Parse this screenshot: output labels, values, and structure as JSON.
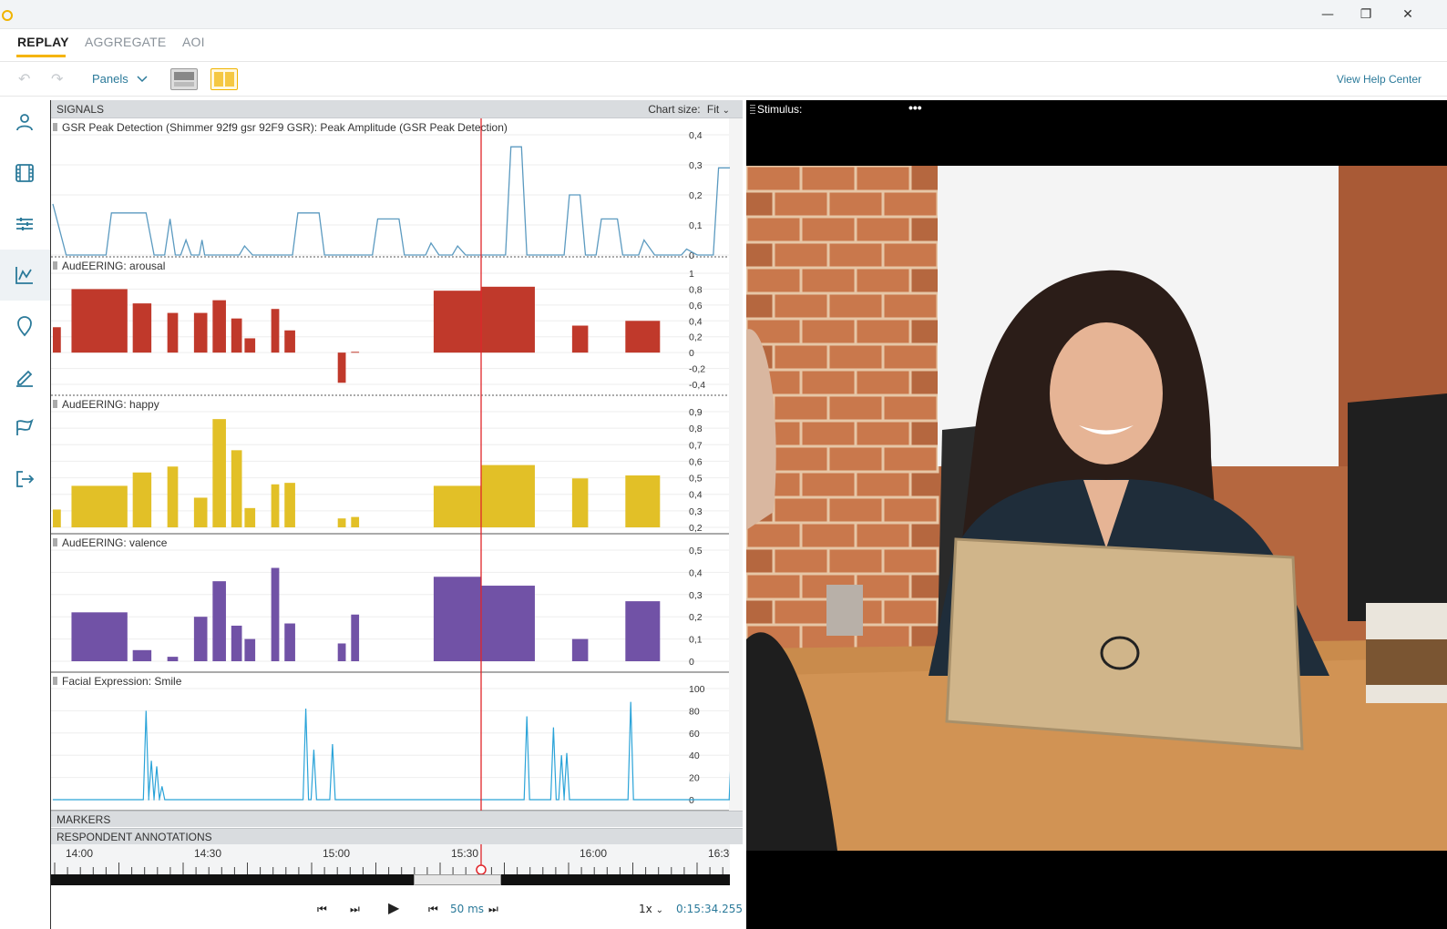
{
  "window": {
    "minimize": "—",
    "restore": "❐",
    "close": "✕"
  },
  "tabs": [
    {
      "label": "REPLAY"
    },
    {
      "label": "AGGREGATE"
    },
    {
      "label": "AOI"
    }
  ],
  "toolbar": {
    "undo": "↶",
    "redo": "↷",
    "panels_label": "Panels",
    "help_label": "View Help Center"
  },
  "sidebar": {
    "items": [
      "respondents-icon",
      "stimuli-icon",
      "settings-sliders-icon",
      "signals-chart-icon",
      "location-pin-icon",
      "annotate-pen-icon",
      "markers-flag-icon",
      "exit-icon"
    ]
  },
  "signals": {
    "header": "SIGNALS",
    "chart_size_label": "Chart size:",
    "chart_size_value": "Fit"
  },
  "chart_data": [
    {
      "type": "line",
      "title": "GSR Peak Detection (Shimmer 92f9 gsr 92F9 GSR): Peak Amplitude (GSR Peak Detection)",
      "y_ticks": [
        "0,4",
        "0,3",
        "0,2",
        "0,1",
        "0"
      ],
      "ylim": [
        0,
        0.4
      ],
      "points": [
        [
          0,
          0.17
        ],
        [
          0.05,
          0
        ],
        [
          0.2,
          0
        ],
        [
          0.22,
          0.14
        ],
        [
          0.35,
          0.14
        ],
        [
          0.38,
          0
        ],
        [
          0.42,
          0
        ],
        [
          0.44,
          0.12
        ],
        [
          0.46,
          0
        ],
        [
          0.48,
          0
        ],
        [
          0.5,
          0.05
        ],
        [
          0.52,
          0
        ],
        [
          0.55,
          0
        ],
        [
          0.56,
          0.05
        ],
        [
          0.57,
          0
        ],
        [
          0.7,
          0
        ],
        [
          0.72,
          0.03
        ],
        [
          0.75,
          0
        ],
        [
          0.9,
          0
        ],
        [
          0.92,
          0.14
        ],
        [
          1.0,
          0.14
        ],
        [
          1.02,
          0
        ],
        [
          1.2,
          0
        ],
        [
          1.22,
          0.12
        ],
        [
          1.3,
          0.12
        ],
        [
          1.32,
          0
        ],
        [
          1.4,
          0
        ],
        [
          1.42,
          0.04
        ],
        [
          1.45,
          0
        ],
        [
          1.5,
          0
        ],
        [
          1.52,
          0.03
        ],
        [
          1.55,
          0
        ],
        [
          1.7,
          0
        ],
        [
          1.72,
          0.36
        ],
        [
          1.76,
          0.36
        ],
        [
          1.78,
          0
        ],
        [
          1.92,
          0
        ],
        [
          1.94,
          0.2
        ],
        [
          1.98,
          0.2
        ],
        [
          2.0,
          0
        ],
        [
          2.04,
          0
        ],
        [
          2.06,
          0.12
        ],
        [
          2.12,
          0.12
        ],
        [
          2.14,
          0
        ],
        [
          2.2,
          0
        ],
        [
          2.22,
          0.05
        ],
        [
          2.26,
          0
        ],
        [
          2.36,
          0
        ],
        [
          2.38,
          0.02
        ],
        [
          2.42,
          0
        ],
        [
          2.48,
          0
        ],
        [
          2.5,
          0.29
        ],
        [
          2.56,
          0.29
        ],
        [
          2.58,
          0
        ],
        [
          2.65,
          0
        ],
        [
          2.66,
          0.16
        ],
        [
          2.72,
          0.16
        ],
        [
          2.74,
          0
        ]
      ]
    },
    {
      "type": "bar",
      "title": "AudEERING: arousal",
      "y_ticks": [
        "1",
        "0,8",
        "0,6",
        "0,4",
        "0,2",
        "0",
        "-0,2",
        "-0,4"
      ],
      "ylim": [
        -0.4,
        1
      ],
      "bars": [
        [
          0,
          0.03,
          0.32
        ],
        [
          0.07,
          0.28,
          0.8
        ],
        [
          0.3,
          0.37,
          0.62
        ],
        [
          0.43,
          0.47,
          0.5
        ],
        [
          0.53,
          0.58,
          0.5
        ],
        [
          0.6,
          0.65,
          0.66
        ],
        [
          0.67,
          0.71,
          0.43
        ],
        [
          0.72,
          0.76,
          0.18
        ],
        [
          0.82,
          0.85,
          0.55
        ],
        [
          0.87,
          0.91,
          0.28
        ],
        [
          1.07,
          1.1,
          -0.38
        ],
        [
          1.12,
          1.15,
          0.01
        ],
        [
          1.43,
          1.61,
          0.78
        ],
        [
          1.61,
          1.81,
          0.83
        ],
        [
          1.95,
          2.01,
          0.34
        ],
        [
          2.15,
          2.28,
          0.4
        ]
      ],
      "color": "#c0392b"
    },
    {
      "type": "bar",
      "title": "AudEERING: happy",
      "y_ticks": [
        "0,9",
        "0,8",
        "0,7",
        "0,6",
        "0,5",
        "0,4",
        "0,3",
        "0,2"
      ],
      "ylim": [
        0.15,
        0.93
      ],
      "bars": [
        [
          0,
          0.03,
          0.27
        ],
        [
          0.07,
          0.28,
          0.43
        ],
        [
          0.3,
          0.37,
          0.52
        ],
        [
          0.43,
          0.47,
          0.56
        ],
        [
          0.53,
          0.58,
          0.35
        ],
        [
          0.6,
          0.65,
          0.88
        ],
        [
          0.67,
          0.71,
          0.67
        ],
        [
          0.72,
          0.76,
          0.28
        ],
        [
          0.82,
          0.85,
          0.44
        ],
        [
          0.87,
          0.91,
          0.45
        ],
        [
          1.07,
          1.1,
          0.21
        ],
        [
          1.12,
          1.15,
          0.22
        ],
        [
          1.43,
          1.61,
          0.43
        ],
        [
          1.61,
          1.81,
          0.57
        ],
        [
          1.95,
          2.01,
          0.48
        ],
        [
          2.15,
          2.28,
          0.5
        ]
      ],
      "color": "#e2c027"
    },
    {
      "type": "bar",
      "title": "AudEERING: valence",
      "y_ticks": [
        "0,5",
        "0,4",
        "0,3",
        "0,2",
        "0,1",
        "0"
      ],
      "ylim": [
        0,
        0.5
      ],
      "bars": [
        [
          0.07,
          0.28,
          0.22
        ],
        [
          0.3,
          0.37,
          0.05
        ],
        [
          0.43,
          0.47,
          0.02
        ],
        [
          0.53,
          0.58,
          0.2
        ],
        [
          0.6,
          0.65,
          0.36
        ],
        [
          0.67,
          0.71,
          0.16
        ],
        [
          0.72,
          0.76,
          0.1
        ],
        [
          0.82,
          0.85,
          0.42
        ],
        [
          0.87,
          0.91,
          0.17
        ],
        [
          1.07,
          1.1,
          0.08
        ],
        [
          1.12,
          1.15,
          0.21
        ],
        [
          1.43,
          1.61,
          0.38
        ],
        [
          1.61,
          1.81,
          0.34
        ],
        [
          1.95,
          2.01,
          0.1
        ],
        [
          2.15,
          2.28,
          0.27
        ]
      ],
      "color": "#7152a6"
    },
    {
      "type": "line",
      "title": "Facial Expression: Smile",
      "y_ticks": [
        "100",
        "80",
        "60",
        "40",
        "20",
        "0"
      ],
      "ylim": [
        0,
        100
      ],
      "spikes": [
        [
          0.35,
          80
        ],
        [
          0.37,
          35
        ],
        [
          0.39,
          30
        ],
        [
          0.41,
          12
        ],
        [
          0.95,
          82
        ],
        [
          0.98,
          45
        ],
        [
          1.05,
          50
        ],
        [
          1.78,
          75
        ],
        [
          1.88,
          65
        ],
        [
          1.91,
          40
        ],
        [
          1.93,
          42
        ],
        [
          2.17,
          88
        ],
        [
          2.55,
          55
        ]
      ],
      "color": "#2aa3d8"
    }
  ],
  "markers": "MARKERS",
  "annotations": "RESPONDENT ANNOTATIONS",
  "timeline": {
    "labels": [
      "14:00",
      "14:30",
      "15:00",
      "15:30",
      "16:00",
      "16:30"
    ]
  },
  "controls": {
    "step": "50 ms",
    "speed": "1x",
    "time": "0:15:34.255"
  },
  "stimulus": {
    "label": "Stimulus:",
    "more": "•••"
  }
}
